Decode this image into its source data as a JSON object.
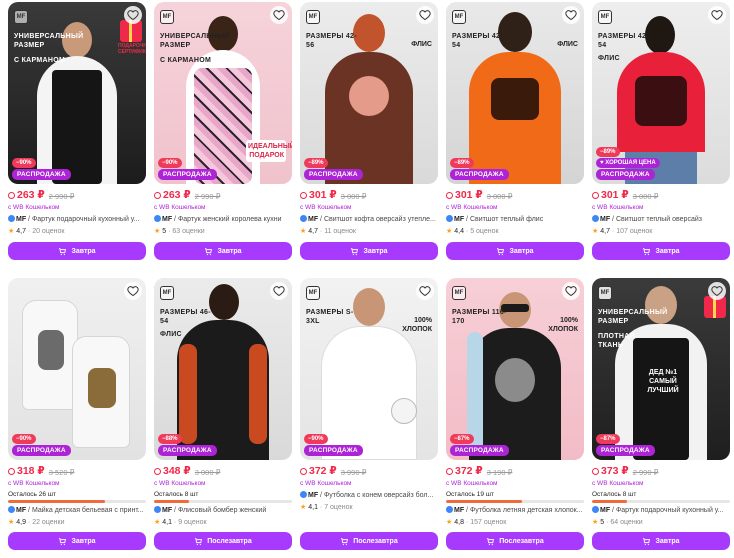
{
  "cards": [
    {
      "discount": "−90%",
      "sale": "РАСПРОДАЖА",
      "price": "263 ₽",
      "old_price": "2 990 ₽",
      "wallet": "с WB Кошельком",
      "brand": "MF",
      "title": " / Фартук подарочный кухонный у...",
      "rating": "4,7",
      "reviews": "20 оценок",
      "button": "Завтра",
      "tag": "УНИВЕРСАЛЬНЫЙ РАЗМЕР",
      "tag2": "С КАРМАНОМ",
      "gift": "ПОДАРОЧНЫЙ СЕРТИФИКАТ"
    },
    {
      "discount": "−90%",
      "sale": "РАСПРОДАЖА",
      "price": "263 ₽",
      "old_price": "2 990 ₽",
      "wallet": "с WB Кошельком",
      "brand": "MF",
      "title": " / Фартук женский королева кухни",
      "rating": "5",
      "reviews": "63 оценки",
      "button": "Завтра",
      "tag": "УНИВЕРСАЛЬНЫЙ РАЗМЕР",
      "tag2": "С КАРМАНОМ",
      "art": "ИДЕАЛЬНЫЙ ПОДАРОК"
    },
    {
      "discount": "−89%",
      "sale": "РАСПРОДАЖА",
      "price": "301 ₽",
      "old_price": "3 000 ₽",
      "wallet": "с WB Кошельком",
      "brand": "MF",
      "title": " / Свитшот кофта оверсайз утепле...",
      "rating": "4,7",
      "reviews": "11 оценок",
      "button": "Завтра",
      "tag": "РАЗМЕРЫ 42-56",
      "side": "ФЛИС"
    },
    {
      "discount": "−89%",
      "sale": "РАСПРОДАЖА",
      "price": "301 ₽",
      "old_price": "3 000 ₽",
      "wallet": "с WB Кошельком",
      "brand": "MF",
      "title": " / Свитшот теплый флис",
      "rating": "4,4",
      "reviews": "5 оценок",
      "button": "Завтра",
      "tag": "РАЗМЕРЫ 42-54",
      "side": "ФЛИС"
    },
    {
      "discount": "−89%",
      "goodprice": "♥ ХОРОШАЯ ЦЕНА",
      "sale": "РАСПРОДАЖА",
      "price": "301 ₽",
      "old_price": "3 000 ₽",
      "wallet": "с WB Кошельком",
      "brand": "MF",
      "title": " / Свитшот теплый оверсайз",
      "rating": "4,7",
      "reviews": "107 оценок",
      "button": "Завтра",
      "tag": "РАЗМЕРЫ 42-54",
      "tag2": "ФЛИС"
    },
    {
      "discount": "−90%",
      "sale": "РАСПРОДАЖА",
      "price": "318 ₽",
      "old_price": "3 520 ₽",
      "wallet": "с WB Кошельком",
      "remain": "Осталось 26 шт",
      "remain_fill": 0.7,
      "brand": "MF",
      "title": " / Майка детская бельевая с принт...",
      "rating": "4,9",
      "reviews": "22 оценки",
      "button": "Завтра"
    },
    {
      "discount": "−88%",
      "sale": "РАСПРОДАЖА",
      "price": "348 ₽",
      "old_price": "3 000 ₽",
      "wallet": "с WB Кошельком",
      "remain": "Осталось 8 шт",
      "remain_fill": 0.25,
      "brand": "MF",
      "title": " / Флисовый бомбер женский",
      "rating": "4,1",
      "reviews": "9 оценок",
      "button": "Послезавтра",
      "tag": "РАЗМЕРЫ 46-54",
      "tag2": "ФЛИС"
    },
    {
      "discount": "−90%",
      "sale": "РАСПРОДАЖА",
      "price": "372 ₽",
      "old_price": "3 990 ₽",
      "wallet": "с WB Кошельком",
      "brand": "MF",
      "title": " / Футболка с конем оверсайз бол...",
      "rating": "4,1",
      "reviews": "7 оценок",
      "button": "Послезавтра",
      "tag": "РАЗМЕРЫ S-3XL",
      "side": "100% ХЛОПОК"
    },
    {
      "discount": "−87%",
      "sale": "РАСПРОДАЖА",
      "price": "372 ₽",
      "old_price": "3 190 ₽",
      "wallet": "с WB Кошельком",
      "remain": "Осталось 19 шт",
      "remain_fill": 0.55,
      "brand": "MF",
      "title": " / Футболка летняя детская хлопок...",
      "rating": "4,8",
      "reviews": "157 оценок",
      "button": "Послезавтра",
      "tag": "РАЗМЕРЫ 116-170",
      "side": "100% ХЛОПОК"
    },
    {
      "discount": "−87%",
      "sale": "РАСПРОДАЖА",
      "price": "373 ₽",
      "old_price": "2 990 ₽",
      "wallet": "с WB Кошельком",
      "remain": "Осталось 8 шт",
      "remain_fill": 0.25,
      "brand": "MF",
      "title": " / Фартук подарочный кухонный у...",
      "rating": "5",
      "reviews": "64 оценки",
      "button": "Завтра",
      "tag": "УНИВЕРСАЛЬНЫЙ РАЗМЕР",
      "tag2": "ПЛОТНАЯ ТКАНЬ",
      "art": "ДЕД №1 САМЫЙ ЛУЧШИЙ"
    }
  ]
}
